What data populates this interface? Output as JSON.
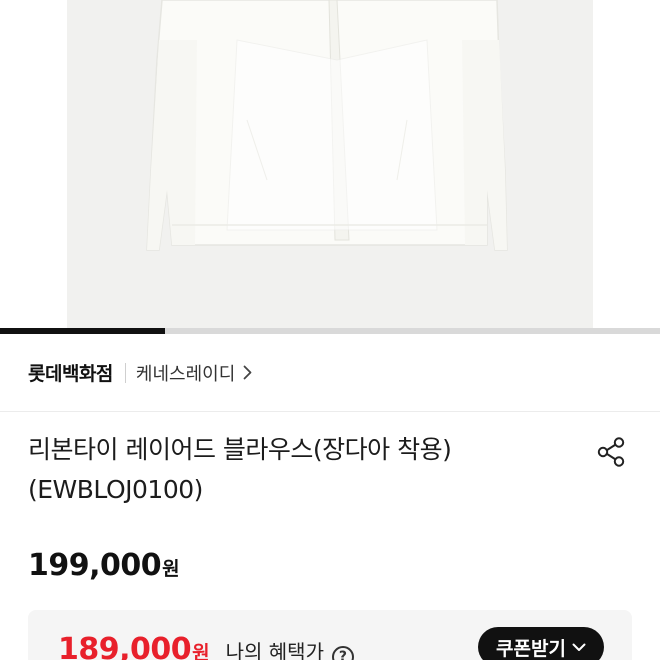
{
  "product_image": {
    "icon": "white-blouse-photo"
  },
  "carousel": {
    "progress": 0.25
  },
  "brand": {
    "store": "롯데백화점",
    "name": "케네스레이디"
  },
  "product": {
    "title_line1": "리본타이 레이어드 블라우스(장다아 착용)",
    "title_line2": "(EWBLOJ0100)"
  },
  "price": {
    "original": "199,000",
    "currency": "원"
  },
  "benefit": {
    "price": "189,000",
    "currency": "원",
    "label": "나의 혜택가",
    "help_symbol": "?",
    "coupon_button": "쿠폰받기"
  },
  "colors": {
    "accent_red": "#e8202b",
    "dark": "#111111"
  }
}
